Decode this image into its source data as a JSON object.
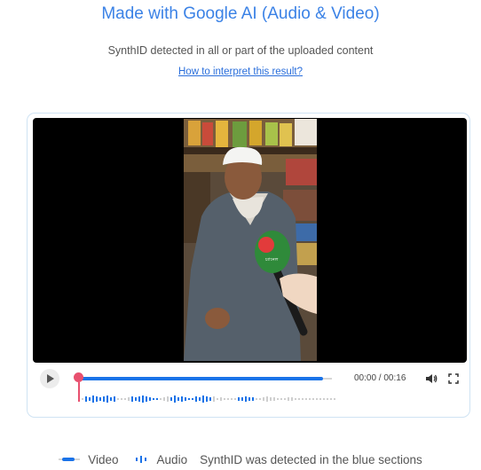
{
  "header": {
    "title": "Made with Google AI (Audio & Video)",
    "subtitle": "SynthID detected in all or part of the uploaded content",
    "help_link": "How to interpret this result?"
  },
  "player": {
    "time": "00:00 / 00:16",
    "progress_fraction": 0.0,
    "mic_text": "বাংলা\nচ্যানেল"
  },
  "legend": {
    "video_label": "Video",
    "audio_label": "Audio",
    "note": "SynthID was detected in the blue sections"
  },
  "colors": {
    "accent_blue": "#1a73e8",
    "marker_red": "#e8506f",
    "title_blue": "#3b82e6"
  },
  "icons": {
    "play": "play-icon",
    "volume": "volume-icon",
    "fullscreen": "fullscreen-icon"
  }
}
